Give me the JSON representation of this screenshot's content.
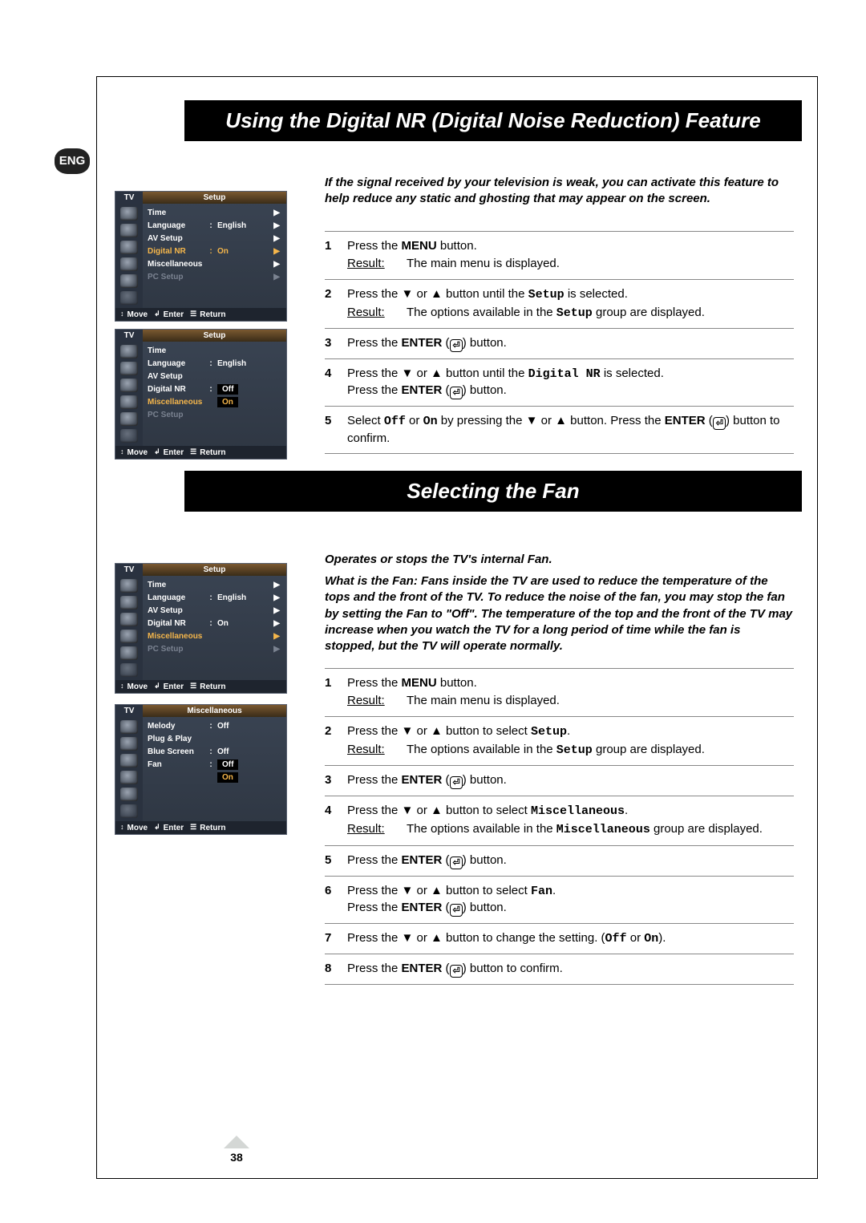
{
  "eng_badge": "ENG",
  "titles": {
    "digital_nr": "Using the Digital NR (Digital Noise Reduction) Feature",
    "fan": "Selecting the Fan"
  },
  "intro": {
    "digital_nr": "If the signal received by your television is weak, you can activate this feature to help reduce any static and ghosting that may appear on the screen.",
    "fan_lead": "Operates or stops the TV's internal Fan.",
    "fan_body": "What is the Fan: Fans inside the TV are used to reduce the temperature of the tops and the front of the TV. To reduce the noise of the fan, you may stop the fan by setting the Fan to \"Off\". The temperature of the top and the front of the TV may increase when you watch the TV for a long period of time while the fan is stopped, but the TV will operate normally."
  },
  "osd_common": {
    "tv": "TV",
    "move": "Move",
    "enter": "Enter",
    "return": "Return",
    "arrow": "▶",
    "move_icon": "↕",
    "enter_icon": "↲",
    "return_icon": "☰"
  },
  "osd": [
    {
      "title": "Setup",
      "rows": [
        {
          "k": "Time",
          "a": true
        },
        {
          "k": "Language",
          "sep": ":",
          "v": "English",
          "a": true
        },
        {
          "k": "AV Setup",
          "a": true
        },
        {
          "k": "Digital NR",
          "sep": ":",
          "v": "On",
          "a": true,
          "hl": true
        },
        {
          "k": "Miscellaneous",
          "a": true
        },
        {
          "k": "PC Setup",
          "a": true,
          "dim": true
        }
      ]
    },
    {
      "title": "Setup",
      "rows": [
        {
          "k": "Time"
        },
        {
          "k": "Language",
          "sep": ":",
          "v": "English"
        },
        {
          "k": "AV Setup"
        },
        {
          "k": "Digital NR",
          "sep": ":",
          "v": "Off",
          "tag": true
        },
        {
          "k": "Miscellaneous",
          "vr": "On",
          "hl": true
        },
        {
          "k": "PC Setup",
          "dim": true
        }
      ]
    },
    {
      "title": "Setup",
      "rows": [
        {
          "k": "Time",
          "a": true
        },
        {
          "k": "Language",
          "sep": ":",
          "v": "English",
          "a": true
        },
        {
          "k": "AV Setup",
          "a": true
        },
        {
          "k": "Digital NR",
          "sep": ":",
          "v": "On",
          "a": true
        },
        {
          "k": "Miscellaneous",
          "a": true,
          "hl": true
        },
        {
          "k": "PC Setup",
          "a": true,
          "dim": true
        }
      ]
    },
    {
      "title": "Miscellaneous",
      "rows": [
        {
          "k": "Melody",
          "sep": ":",
          "v": "Off"
        },
        {
          "k": "Plug & Play"
        },
        {
          "k": "Blue Screen",
          "sep": ":",
          "v": "Off"
        },
        {
          "k": "Fan",
          "sep": ":",
          "v": "Off",
          "tag": true
        },
        {
          "k": "",
          "vr": "On",
          "hl": true
        }
      ]
    }
  ],
  "steps_nr": [
    {
      "n": "1",
      "text_parts": [
        "Press the ",
        {
          "b": "MENU"
        },
        " button."
      ],
      "result": "The main menu is displayed."
    },
    {
      "n": "2",
      "text_parts": [
        "Press the ▼ or ▲ button until the ",
        {
          "mono": "Setup"
        },
        " is selected."
      ],
      "result_parts": [
        "The options available in the ",
        {
          "mono": "Setup"
        },
        " group are displayed."
      ]
    },
    {
      "n": "3",
      "text_parts": [
        "Press the ",
        {
          "b": "ENTER"
        },
        " (",
        {
          "ico": true
        },
        ") button."
      ]
    },
    {
      "n": "4",
      "text_parts": [
        "Press the ▼ or ▲ button until the ",
        {
          "mono": "Digital NR"
        },
        " is selected.\nPress the ",
        {
          "b": "ENTER"
        },
        " (",
        {
          "ico": true
        },
        ") button."
      ]
    },
    {
      "n": "5",
      "text_parts": [
        "Select ",
        {
          "mono": "Off"
        },
        " or ",
        {
          "mono": "On"
        },
        "  by pressing the ▼ or ▲ button. Press the ",
        {
          "b": "ENTER"
        },
        " (",
        {
          "ico": true
        },
        ") button to confirm."
      ]
    }
  ],
  "steps_fan": [
    {
      "n": "1",
      "text_parts": [
        "Press the ",
        {
          "b": "MENU"
        },
        " button."
      ],
      "result": "The main menu is displayed."
    },
    {
      "n": "2",
      "text_parts": [
        "Press the ▼ or ▲ button to select ",
        {
          "mono": "Setup"
        },
        "."
      ],
      "result_parts": [
        "The options available in the ",
        {
          "mono": "Setup"
        },
        " group are displayed."
      ]
    },
    {
      "n": "3",
      "text_parts": [
        "Press the ",
        {
          "b": "ENTER"
        },
        " (",
        {
          "ico": true
        },
        ") button."
      ]
    },
    {
      "n": "4",
      "text_parts": [
        "Press the ▼ or ▲ button to select ",
        {
          "mono": "Miscellaneous"
        },
        "."
      ],
      "result_parts": [
        "The options available in the ",
        {
          "mono": "Miscellaneous"
        },
        " group are displayed."
      ]
    },
    {
      "n": "5",
      "text_parts": [
        "Press the ",
        {
          "b": "ENTER"
        },
        " (",
        {
          "ico": true
        },
        ") button."
      ]
    },
    {
      "n": "6",
      "text_parts": [
        "Press the ▼ or ▲ button to select ",
        {
          "mono": "Fan"
        },
        ".\nPress the ",
        {
          "b": "ENTER"
        },
        " (",
        {
          "ico": true
        },
        ") button."
      ]
    },
    {
      "n": "7",
      "text_parts": [
        "Press the ▼ or ▲ button to change the setting. (",
        {
          "mono": "Off"
        },
        " or ",
        {
          "mono": "On"
        },
        ")."
      ]
    },
    {
      "n": "8",
      "text_parts": [
        "Press the ",
        {
          "b": "ENTER"
        },
        " (",
        {
          "ico": true
        },
        ") button to confirm."
      ]
    }
  ],
  "result_label": "Result:",
  "page_number": "38",
  "osd_positions": [
    238,
    410,
    702,
    878
  ]
}
